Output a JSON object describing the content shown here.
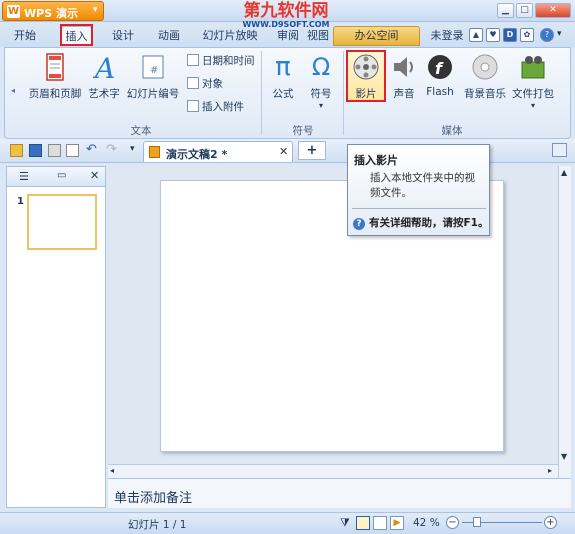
{
  "app": {
    "title": "WPS 演示",
    "dropdown_glyph": "▾"
  },
  "watermark": {
    "line1": "第九软件网",
    "line2": "WWW.D9SOFT.COM"
  },
  "window_controls": [
    "▁",
    "□",
    "✕"
  ],
  "menu_tabs": [
    {
      "label": "开始"
    },
    {
      "label": "插入"
    },
    {
      "label": "设计"
    },
    {
      "label": "动画"
    },
    {
      "label": "幻灯片放映"
    },
    {
      "label": "审阅"
    },
    {
      "label": "视图"
    }
  ],
  "office_tab": "办公空间",
  "user": {
    "login": "未登录"
  },
  "ribbon": {
    "text_group": {
      "label": "文本",
      "header_footer": "页眉和页脚",
      "art_text": "艺术字",
      "slide_number": "幻灯片编号",
      "date_time": "日期和时间",
      "object": "对象",
      "attachment": "插入附件"
    },
    "symbol_group": {
      "label": "符号",
      "formula": "公式",
      "symbol": "符号",
      "pi_glyph": "π",
      "omega_glyph": "Ω"
    },
    "media_group": {
      "label": "媒体",
      "movie": "影片",
      "sound": "声音",
      "flash": "Flash",
      "bg_music": "背景音乐",
      "package": "文件打包"
    }
  },
  "doc_tab": {
    "name": "演示文稿2 *",
    "close": "✕",
    "new": "+"
  },
  "tooltip": {
    "title": "插入影片",
    "body": "插入本地文件夹中的视频文件。",
    "help": "有关详细帮助，请按F1。"
  },
  "slide_panel": {
    "slide_number": "1"
  },
  "notes": {
    "placeholder": "单击添加备注"
  },
  "status": {
    "slide_info": "幻灯片 1 / 1",
    "zoom": "42 %"
  },
  "colors": {
    "accent": "#f08a00",
    "highlight": "#e0202a",
    "ribbon_bg": "#dfe9f6"
  }
}
